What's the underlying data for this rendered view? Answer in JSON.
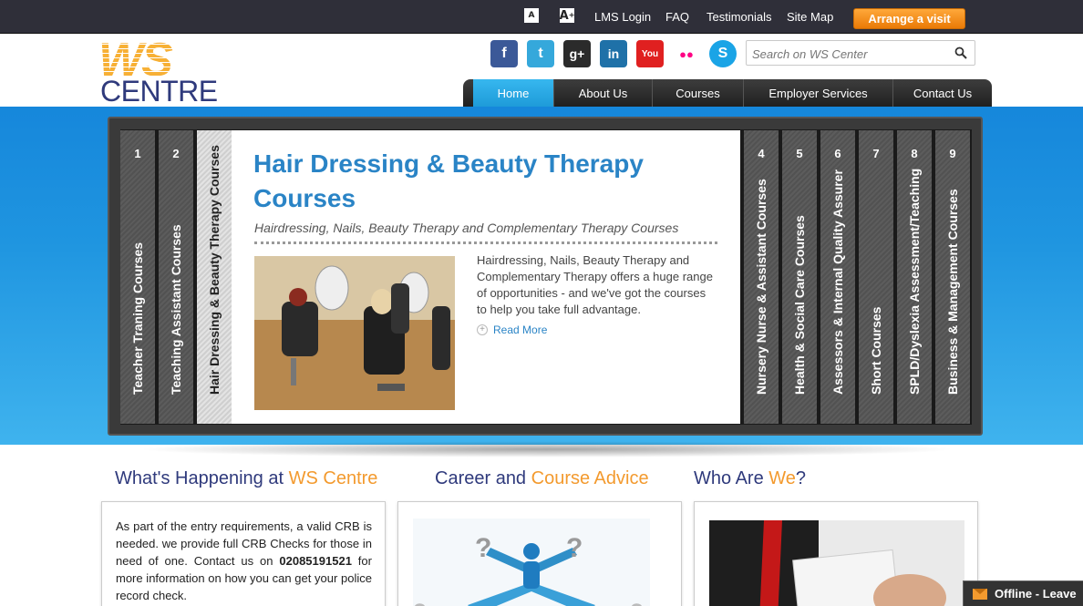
{
  "topbar": {
    "font_small": "A",
    "font_large": "A",
    "links": [
      "LMS Login",
      "FAQ",
      "Testimonials",
      "Site Map"
    ],
    "visit_label": "Arrange a visit",
    "visit_color": "#f08a14"
  },
  "logo": {
    "top": "WS",
    "bottom": "CENTRE"
  },
  "socials": [
    {
      "icon": "facebook-icon",
      "glyph": "f",
      "color": "#3b5998"
    },
    {
      "icon": "twitter-icon",
      "glyph": "t",
      "color": "#35a8db"
    },
    {
      "icon": "google-plus-icon",
      "glyph": "g+",
      "color": "#2b2b2b"
    },
    {
      "icon": "linkedin-icon",
      "glyph": "in",
      "color": "#1f71a8"
    },
    {
      "icon": "youtube-icon",
      "glyph": "You",
      "color": "#e02020"
    },
    {
      "icon": "flickr-icon",
      "glyph": "●●",
      "color": "#ffffff"
    },
    {
      "icon": "skype-icon",
      "glyph": "S",
      "color": "#1aa4e6"
    }
  ],
  "search": {
    "placeholder": "Search on WS Center"
  },
  "nav": [
    "Home",
    "About Us",
    "Courses",
    "Employer Services",
    "Contact Us"
  ],
  "slider": {
    "tabs_left": [
      {
        "num": "1",
        "label": "Teacher Traning Courses"
      },
      {
        "num": "2",
        "label": "Teaching Assistant Courses"
      },
      {
        "num": "3",
        "label": "Hair Dressing & Beauty Therapy Courses"
      }
    ],
    "tabs_right": [
      {
        "num": "4",
        "label": "Nursery Nurse & Assistant Courses"
      },
      {
        "num": "5",
        "label": "Health & Social Care Courses"
      },
      {
        "num": "6",
        "label": "Assessors & Internal Quality Assurer"
      },
      {
        "num": "7",
        "label": "Short Courses"
      },
      {
        "num": "8",
        "label": "SPLD/Dyslexia Assessment/Teaching"
      },
      {
        "num": "9",
        "label": "Business & Management Courses"
      }
    ],
    "panel": {
      "title": "Hair Dressing & Beauty Therapy Courses",
      "subtitle": "Hairdressing, Nails, Beauty Therapy and Complementary Therapy Courses",
      "text": "Hairdressing, Nails, Beauty Therapy and Complementary Therapy offers a huge range of opportunities - and we've got the courses to help you take full advantage.",
      "read_more": "Read More"
    }
  },
  "columns": [
    {
      "title_a": "What's Happening at ",
      "title_b": "WS Centre",
      "title_c": ""
    },
    {
      "title_a": "Career and ",
      "title_b": "Course Advice",
      "title_c": ""
    },
    {
      "title_a": "Who Are ",
      "title_b": "We",
      "title_c": "?"
    }
  ],
  "happening": {
    "text_a": "As part of the entry requirements, a valid CRB is needed. we provide full CRB Checks for those in need of one. Contact us on ",
    "phone": "02085191521",
    "text_b": " for more information on how you can get your police record check."
  },
  "chat": {
    "label": "Offline - Leave"
  }
}
